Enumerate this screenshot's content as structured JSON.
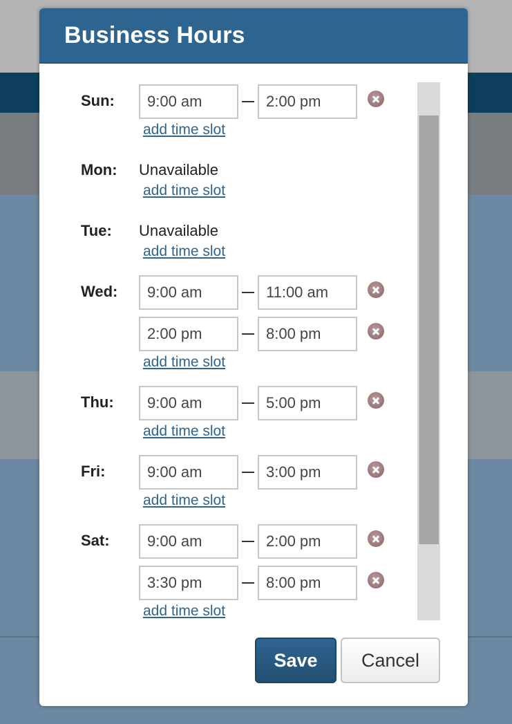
{
  "modal": {
    "title": "Business Hours",
    "add_slot_label": "add time slot",
    "unavailable_label": "Unavailable",
    "save_label": "Save",
    "cancel_label": "Cancel"
  },
  "days": [
    {
      "label": "Sun:",
      "slots": [
        [
          "9:00 am",
          "2:00 pm"
        ]
      ]
    },
    {
      "label": "Mon:",
      "slots": []
    },
    {
      "label": "Tue:",
      "slots": []
    },
    {
      "label": "Wed:",
      "slots": [
        [
          "9:00 am",
          "11:00 am"
        ],
        [
          "2:00 pm",
          "8:00 pm"
        ]
      ]
    },
    {
      "label": "Thu:",
      "slots": [
        [
          "9:00 am",
          "5:00 pm"
        ]
      ]
    },
    {
      "label": "Fri:",
      "slots": [
        [
          "9:00 am",
          "3:00 pm"
        ]
      ]
    },
    {
      "label": "Sat:",
      "slots": [
        [
          "9:00 am",
          "2:00 pm"
        ],
        [
          "3:30 pm",
          "8:00 pm"
        ]
      ]
    }
  ],
  "colors": {
    "header": "#2e6590",
    "link": "#2e6590",
    "remove_icon": "#8a6565"
  },
  "icons": {
    "remove": "remove-icon"
  }
}
